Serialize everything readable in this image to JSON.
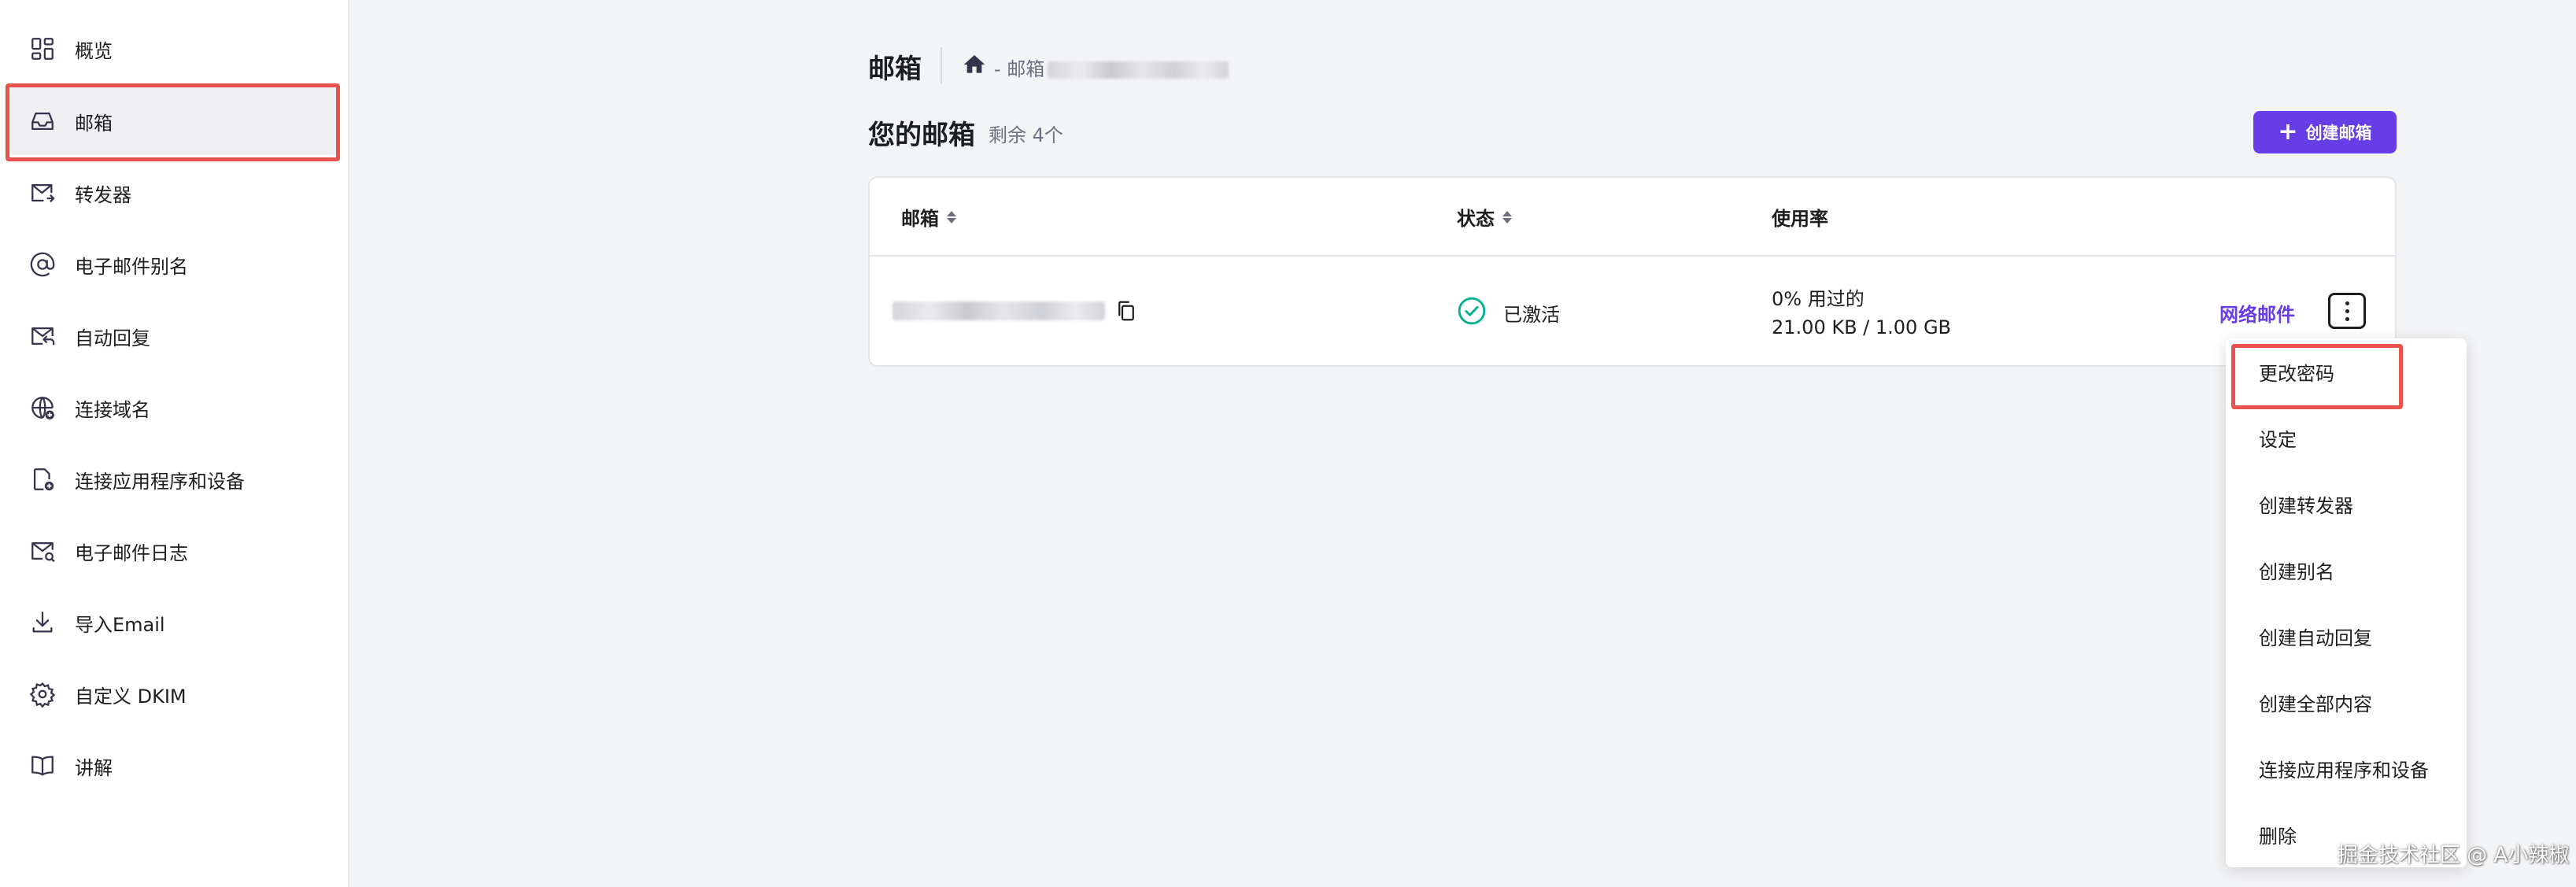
{
  "sidebar": {
    "items": [
      {
        "label": "概览",
        "icon": "grid-icon"
      },
      {
        "label": "邮箱",
        "icon": "inbox-icon",
        "active": true
      },
      {
        "label": "转发器",
        "icon": "mail-forward-icon"
      },
      {
        "label": "电子邮件别名",
        "icon": "at-icon"
      },
      {
        "label": "自动回复",
        "icon": "mail-reply-icon"
      },
      {
        "label": "连接域名",
        "icon": "globe-plus-icon"
      },
      {
        "label": "连接应用程序和设备",
        "icon": "device-plus-icon"
      },
      {
        "label": "电子邮件日志",
        "icon": "mail-search-icon"
      },
      {
        "label": "导入Email",
        "icon": "download-icon"
      },
      {
        "label": "自定义 DKIM",
        "icon": "gear-icon"
      },
      {
        "label": "讲解",
        "icon": "book-icon"
      }
    ]
  },
  "header": {
    "title": "邮箱",
    "breadcrumb": "- 邮箱"
  },
  "mailboxes": {
    "title": "您的邮箱",
    "remaining": "剩余 4个",
    "create_button": "创建邮箱"
  },
  "table": {
    "columns": [
      "邮箱",
      "状态",
      "使用率"
    ],
    "rows": [
      {
        "status": "已激活",
        "usage_percent": "0% 用过的",
        "usage_amount": "21.00 KB / 1.00 GB",
        "webmail_link": "网络邮件"
      }
    ]
  },
  "menu": {
    "items": [
      "更改密码",
      "设定",
      "创建转发器",
      "创建别名",
      "创建自动回复",
      "创建全部内容",
      "连接应用程序和设备",
      "删除"
    ]
  },
  "watermark": "掘金技术社区 @ A小辣椒",
  "colors": {
    "accent": "#673de6",
    "highlight_box": "#e8514c",
    "status_ok": "#00b090"
  }
}
